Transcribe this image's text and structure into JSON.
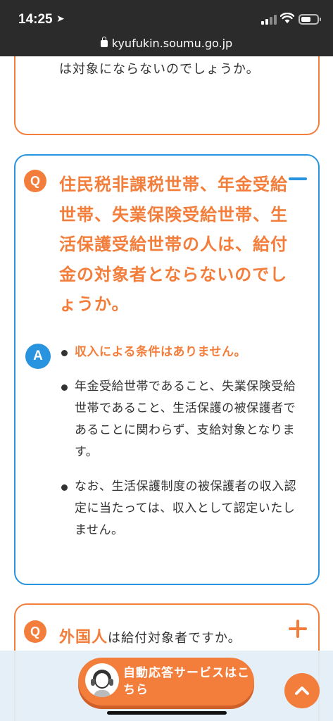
{
  "status_bar": {
    "time": "14:25"
  },
  "browser": {
    "url": "kyufukin.soumu.go.jp"
  },
  "prev_item": {
    "answer_tail": "住民基本台帳に記録されていない場合は対象にならないのでしょうか。"
  },
  "current_item": {
    "q_badge": "Q",
    "question": "住民税非課税世帯、年金受給世帯、失業保険受給世帯、生活保護受給世帯の人は、給付金の対象者とならないのでしょうか。",
    "a_badge": "A",
    "answers": [
      "収入による条件はありません。",
      "年金受給世帯であること、失業保険受給世帯であること、生活保護の被保護者であることに関わらず、支給対象となります。",
      "なお、生活保護制度の被保護者の収入認定に当たっては、収入として認定いたしません。"
    ]
  },
  "next_item": {
    "q_badge": "Q",
    "highlight": "外国人",
    "question_rest": "は給付対象者ですか。"
  },
  "footer": {
    "chat_label": "自動応答サービスはこちら"
  },
  "colors": {
    "accent_orange": "#f37d3a",
    "accent_blue": "#2893de"
  },
  "icons": {
    "collapse": "minus-icon",
    "expand": "plus-icon",
    "scroll_top": "chevron-up-icon"
  }
}
